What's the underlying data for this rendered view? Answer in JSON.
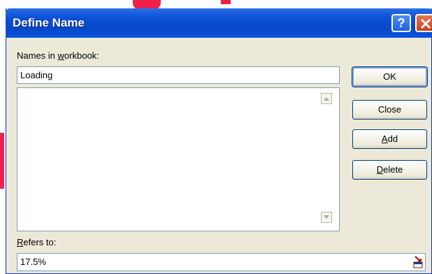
{
  "dialog": {
    "title": "Define Name",
    "help_label": "?",
    "names_label_pre": "Names in ",
    "names_label_key": "w",
    "names_label_post": "orkbook:",
    "name_value": "Loading",
    "refers_label_key": "R",
    "refers_label_post": "efers to:",
    "refers_value": "17.5%"
  },
  "buttons": {
    "ok": "OK",
    "close": "Close",
    "add_key": "A",
    "add_rest": "dd",
    "delete_key": "D",
    "delete_rest": "elete"
  },
  "icons": {
    "help": "help-icon",
    "close": "close-icon",
    "scroll_up": "scroll-up-icon",
    "scroll_down": "scroll-down-icon",
    "collapse": "collapse-dialog-icon"
  },
  "colors": {
    "titlebar": "#0a4fd4",
    "dialog_bg": "#ece9d8",
    "decoration": "#f0204a"
  }
}
